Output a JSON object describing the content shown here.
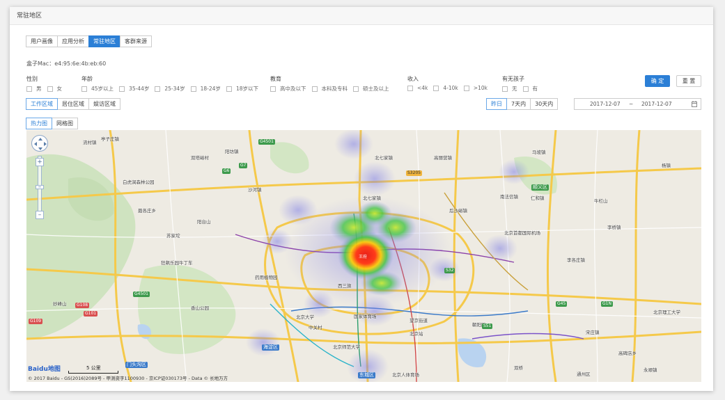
{
  "window": {
    "title": "常驻地区"
  },
  "main_tabs": [
    {
      "label": "用户画像",
      "active": false
    },
    {
      "label": "应用分析",
      "active": false
    },
    {
      "label": "常驻地区",
      "active": true
    },
    {
      "label": "客群来源",
      "active": false
    }
  ],
  "device": {
    "mac_label": "盒子Mac：e4:95:6e:4b:eb:60"
  },
  "filters": {
    "gender": {
      "label": "性别",
      "options": [
        "男",
        "女"
      ]
    },
    "age": {
      "label": "年龄",
      "options": [
        "45岁以上",
        "35-44岁",
        "25-34岁",
        "18-24岁",
        "18岁以下"
      ]
    },
    "education": {
      "label": "教育",
      "options": [
        "高中及以下",
        "本科及专科",
        "硕士及以上"
      ]
    },
    "income": {
      "label": "收入",
      "options": [
        "<4k",
        "4-10k",
        ">10k"
      ]
    },
    "children": {
      "label": "有无孩子",
      "options": [
        "无",
        "有"
      ]
    }
  },
  "actions": {
    "confirm": "确 定",
    "reset": "重 置"
  },
  "area_tabs": [
    {
      "label": "工作区域",
      "active": true
    },
    {
      "label": "居住区域",
      "active": false
    },
    {
      "label": "娱访区域",
      "active": false
    }
  ],
  "time_tabs": [
    {
      "label": "昨日",
      "active": true
    },
    {
      "label": "7天内",
      "active": false
    },
    {
      "label": "30天内",
      "active": false
    }
  ],
  "date_range": {
    "start": "2017-12-07",
    "separator": "~",
    "end": "2017-12-07"
  },
  "map_tabs": [
    {
      "label": "热力图",
      "active": true
    },
    {
      "label": "网格图",
      "active": false
    }
  ],
  "map": {
    "scale_label": "5 公里",
    "logo": "Baidu地图",
    "copyright": "© 2017 Baidu - GS(2016)2089号 - 甲测资字1100930 - 京ICP证030173号 - Data © 长地万方",
    "hotspot_label": "王府",
    "labels": [
      {
        "t": "亭子庄镇"
      },
      {
        "t": "流村镇"
      },
      {
        "t": "双塔峪村"
      },
      {
        "t": "阳坊镇"
      },
      {
        "t": "北七家镇"
      },
      {
        "t": "高丽营镇"
      },
      {
        "t": "白虎涧森林公园"
      },
      {
        "t": "沙河镇"
      },
      {
        "t": "南法信镇"
      },
      {
        "t": "顺义区"
      },
      {
        "t": "仁和镇"
      },
      {
        "t": "杨镇"
      },
      {
        "t": "聂各庄乡"
      },
      {
        "t": "北七家镇"
      },
      {
        "t": "后沙峪镇"
      },
      {
        "t": "李桥镇"
      },
      {
        "t": "苏家坨"
      },
      {
        "t": "阳台山"
      },
      {
        "t": "北京首都国际机场"
      },
      {
        "t": "牛栏山"
      },
      {
        "t": "狂飙乐园牛丁车"
      },
      {
        "t": "药用植物园"
      },
      {
        "t": "西三旗"
      },
      {
        "t": "中关村"
      },
      {
        "t": "北京大学"
      },
      {
        "t": "国家体育场"
      },
      {
        "t": "望京街道"
      },
      {
        "t": "北京理工大学"
      },
      {
        "t": "妙峰山"
      },
      {
        "t": "香山公园"
      },
      {
        "t": "海淀区"
      },
      {
        "t": "北京师范大学"
      },
      {
        "t": "朝阳区"
      },
      {
        "t": "高碑店乡"
      },
      {
        "t": "门头沟区"
      },
      {
        "t": "东城区"
      },
      {
        "t": "北京人体育场"
      },
      {
        "t": "北京站"
      },
      {
        "t": "宋庄镇"
      },
      {
        "t": "永顺镇"
      },
      {
        "t": "通州区"
      },
      {
        "t": "双桥"
      },
      {
        "t": "马坡镇"
      },
      {
        "t": "李各庄镇"
      }
    ],
    "road_badges": [
      {
        "t": "G4501"
      },
      {
        "t": "G6"
      },
      {
        "t": "G7"
      },
      {
        "t": "S3205"
      },
      {
        "t": "S32"
      },
      {
        "t": "G101"
      },
      {
        "t": "G45"
      },
      {
        "t": "G1N"
      },
      {
        "t": "S51"
      },
      {
        "t": "G4501"
      },
      {
        "t": "G108"
      },
      {
        "t": "G109"
      }
    ]
  },
  "colors": {
    "accent": "#2b7fd6",
    "heat_core": "#e8201a",
    "heat_mid": "#ffcc00",
    "heat_low": "#3ec63e",
    "heat_cool": "#8e8ee8"
  }
}
